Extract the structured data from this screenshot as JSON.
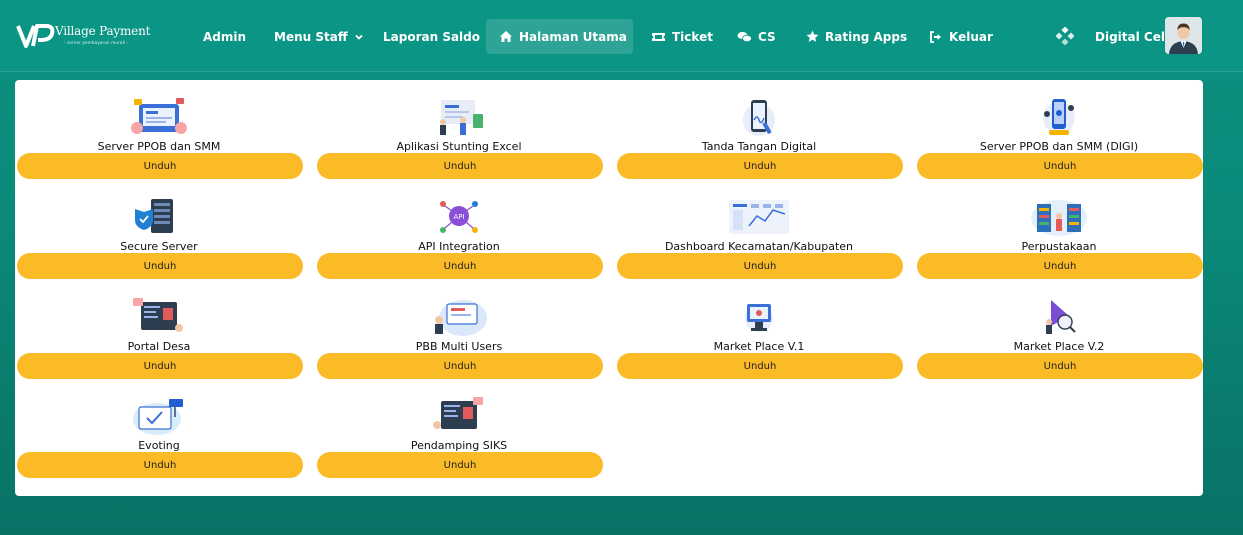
{
  "brand": {
    "name": "Village Payment",
    "tagline": "- server pembayaran murah -"
  },
  "nav": {
    "items": [
      {
        "label": "Admin",
        "icon": "none"
      },
      {
        "label": "Menu Staff",
        "icon": "chevron-down-icon"
      },
      {
        "label": "Laporan Saldo",
        "icon": "none"
      },
      {
        "label": "Halaman Utama",
        "icon": "home-icon",
        "active": true
      },
      {
        "label": "Ticket",
        "icon": "ticket-icon"
      },
      {
        "label": "CS",
        "icon": "chat-icon"
      },
      {
        "label": "Rating Apps",
        "icon": "star-icon"
      },
      {
        "label": "Keluar",
        "icon": "logout-icon"
      }
    ],
    "user": {
      "name": "Digital Cell"
    }
  },
  "apps": [
    {
      "title": "Server PPOB dan SMM",
      "button": "Unduh"
    },
    {
      "title": "Aplikasi Stunting Excel",
      "button": "Unduh"
    },
    {
      "title": "Tanda Tangan Digital",
      "button": "Unduh"
    },
    {
      "title": "Server PPOB dan SMM (DIGI)",
      "button": "Unduh"
    },
    {
      "title": "Secure Server",
      "button": "Unduh"
    },
    {
      "title": "API Integration",
      "button": "Unduh"
    },
    {
      "title": "Dashboard Kecamatan/Kabupaten",
      "button": "Unduh"
    },
    {
      "title": "Perpustakaan",
      "button": "Unduh"
    },
    {
      "title": "Portal Desa",
      "button": "Unduh"
    },
    {
      "title": "PBB Multi Users",
      "button": "Unduh"
    },
    {
      "title": "Market Place V.1",
      "button": "Unduh"
    },
    {
      "title": "Market Place V.2",
      "button": "Unduh"
    },
    {
      "title": "Evoting",
      "button": "Unduh"
    },
    {
      "title": "Pendamping SIKS",
      "button": "Unduh"
    }
  ],
  "colors": {
    "primary": "#0b9584",
    "button": "#fbbb27",
    "card": "#ffffff"
  }
}
